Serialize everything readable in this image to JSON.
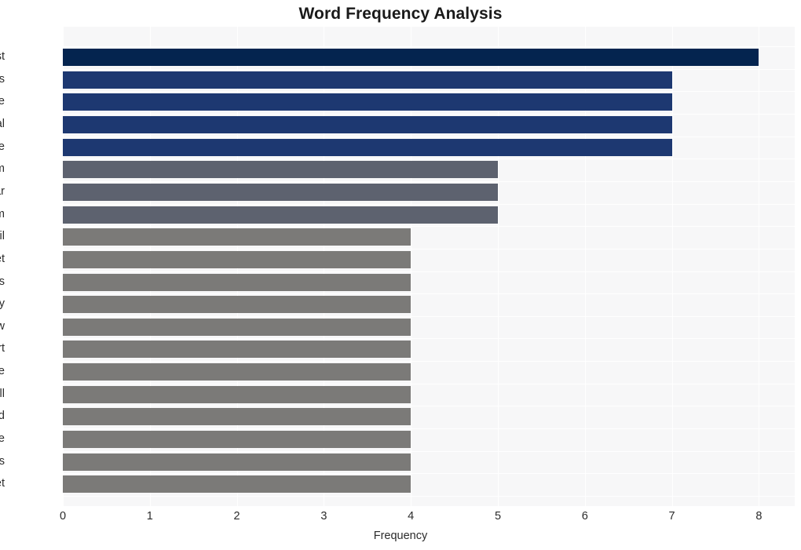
{
  "chart_data": {
    "type": "bar",
    "orientation": "horizontal",
    "title": "Word Frequency Analysis",
    "xlabel": "Frequency",
    "ylabel": "",
    "categories": [
      "list",
      "buyers",
      "home",
      "real",
      "estate",
      "bertram",
      "star",
      "scam",
      "email",
      "market",
      "kansas",
      "city",
      "zillow",
      "report",
      "house",
      "tell",
      "accord",
      "price",
      "bertrams",
      "internet"
    ],
    "values": [
      8,
      7,
      7,
      7,
      7,
      5,
      5,
      5,
      4,
      4,
      4,
      4,
      4,
      4,
      4,
      4,
      4,
      4,
      4,
      4
    ],
    "bar_colors": [
      "#04244f",
      "#1d3871",
      "#1d3871",
      "#1d3871",
      "#1d3871",
      "#5d626f",
      "#5d626f",
      "#5d626f",
      "#7b7a78",
      "#7b7a78",
      "#7b7a78",
      "#7b7a78",
      "#7b7a78",
      "#7b7a78",
      "#7b7a78",
      "#7b7a78",
      "#7b7a78",
      "#7b7a78",
      "#7b7a78",
      "#7b7a78"
    ],
    "xlim": [
      0,
      8
    ],
    "xticks": [
      "0",
      "1",
      "2",
      "3",
      "4",
      "5",
      "6",
      "7",
      "8"
    ],
    "grid": true,
    "legend": false,
    "plot_background": "#f7f7f8",
    "figure_background": "#ffffff",
    "title_color": "#1a1a1a",
    "tick_color": "#2b2b2b"
  }
}
